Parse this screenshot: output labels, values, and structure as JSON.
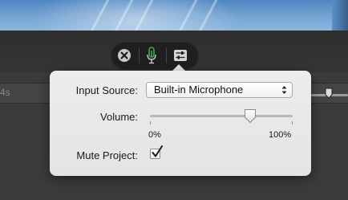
{
  "timeline": {
    "ruler_label": "4s"
  },
  "controls": {
    "cancel_icon": "close-circle-icon",
    "mic_icon": "microphone-icon",
    "settings_icon": "sliders-icon"
  },
  "popover": {
    "input_source_label": "Input Source:",
    "input_source_value": "Built-in Microphone",
    "volume_label": "Volume:",
    "volume_min_label": "0%",
    "volume_max_label": "100%",
    "volume_level": 0.7,
    "mute_label": "Mute Project:",
    "mute_checked": true
  },
  "colors": {
    "mic_accent": "#39b54a",
    "popover_bg": "#e8e8e8",
    "pill_bg": "#1f1f1f"
  }
}
